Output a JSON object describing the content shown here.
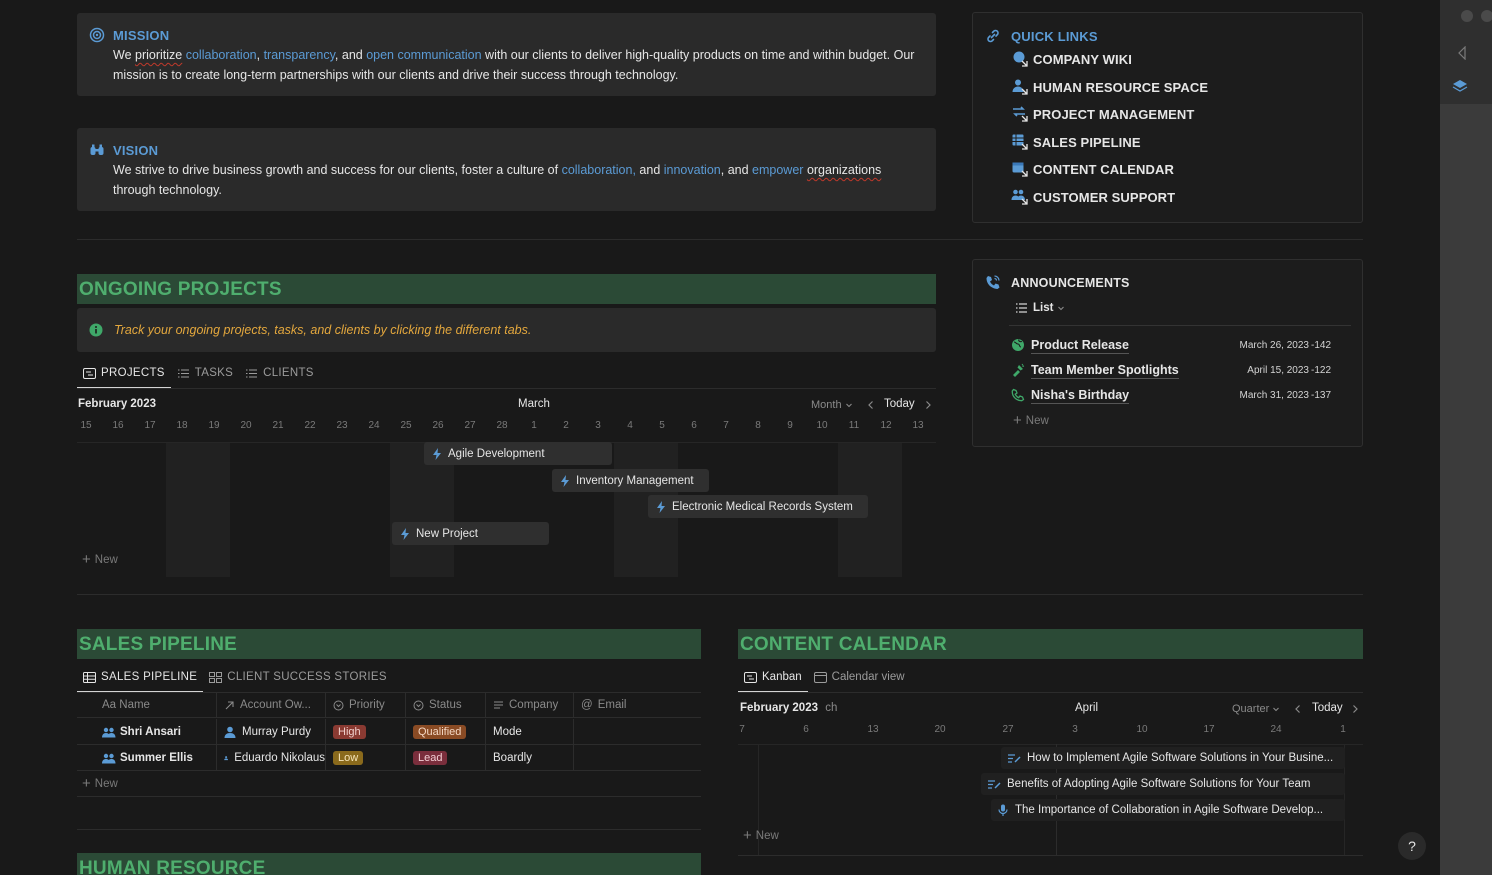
{
  "mission": {
    "title": "MISSION",
    "t1": "We ",
    "t2": "prioritize",
    "t3": " ",
    "l1": "collaboration",
    "t4": ", ",
    "l2": "transparency",
    "t5": ", and ",
    "l3": "open communication",
    "t6": " with our clients to deliver high-quality products on time and within budget. Our mission is to create long-term partnerships with our clients and drive their success through technology."
  },
  "vision": {
    "title": "VISION",
    "t1": "We strive to drive business growth and success for our clients, foster a culture of ",
    "l1": "collaboration,",
    "t2": " and ",
    "l2": "innovation",
    "t3": ", and ",
    "l3": "empower",
    "t4": " ",
    "t5": "organizations",
    "t6": " through technology."
  },
  "quick_links": {
    "title": "QUICK LINKS",
    "items": [
      {
        "label": "COMPANY WIKI"
      },
      {
        "label": "HUMAN RESOURCE SPACE"
      },
      {
        "label": "PROJECT MANAGEMENT"
      },
      {
        "label": "SALES PIPELINE"
      },
      {
        "label": "CONTENT CALENDAR"
      },
      {
        "label": "CUSTOMER SUPPORT"
      }
    ]
  },
  "announcements": {
    "title": "ANNOUNCEMENTS",
    "view_label": "List",
    "items": [
      {
        "title": "Product Release",
        "date": "March 26, 2023",
        "num": "-142",
        "icon": "globe-icon"
      },
      {
        "title": "Team Member Spotlights",
        "date": "April 15, 2023",
        "num": "-122",
        "icon": "flashlight-icon"
      },
      {
        "title": "Nisha's Birthday",
        "date": "March 31, 2023",
        "num": "-137",
        "icon": "phone-icon"
      }
    ],
    "new_label": "New"
  },
  "ongoing": {
    "title": "ONGOING PROJECTS",
    "callout": "Track your ongoing projects, tasks, and clients by clicking the different tabs.",
    "tabs": [
      "PROJECTS",
      "TASKS",
      "CLIENTS"
    ],
    "month_left": "February 2023",
    "month_center": "March",
    "scale_label": "Month",
    "today_label": "Today",
    "days": [
      "15",
      "16",
      "17",
      "18",
      "19",
      "20",
      "21",
      "22",
      "23",
      "24",
      "25",
      "26",
      "27",
      "28",
      "1",
      "2",
      "3",
      "4",
      "5",
      "6",
      "7",
      "8",
      "9",
      "10",
      "11",
      "12",
      "13"
    ],
    "bars": [
      {
        "label": "Agile Development"
      },
      {
        "label": "Inventory Management"
      },
      {
        "label": "Electronic Medical Records System"
      },
      {
        "label": "New Project"
      }
    ],
    "new_label": "New"
  },
  "sales": {
    "title": "SALES PIPELINE",
    "tabs": [
      "SALES PIPELINE",
      "CLIENT SUCCESS STORIES"
    ],
    "columns": [
      "Aa Name",
      "Account Ow...",
      "Priority",
      "Status",
      "Company",
      "Email"
    ],
    "rows": [
      {
        "name": "Shri Ansari",
        "owner": "Murray Purdy",
        "priority": "High",
        "status": "Qualified",
        "company": "Mode",
        "email": ""
      },
      {
        "name": "Summer Ellis",
        "owner": "Eduardo Nikolaus",
        "priority": "Low",
        "status": "Lead",
        "company": "Boardly",
        "email": ""
      }
    ],
    "new_label": "New"
  },
  "content": {
    "title": "CONTENT CALENDAR",
    "tabs": [
      "Kanban",
      "Calendar view"
    ],
    "month_left": "February 2023",
    "month_left_suffix": "ch",
    "month_center": "April",
    "scale_label": "Quarter",
    "today_label": "Today",
    "days": [
      "7",
      "6",
      "13",
      "20",
      "27",
      "3",
      "10",
      "17",
      "24",
      "1"
    ],
    "items": [
      {
        "label": "How to Implement Agile Software Solutions in Your Busine..."
      },
      {
        "label": "Benefits of Adopting Agile Software Solutions for Your Team"
      },
      {
        "label": "The Importance of Collaboration in Agile Software Develop..."
      }
    ],
    "new_label": "New"
  },
  "human_resource": {
    "title": "HUMAN RESOURCE"
  },
  "help_label": "?",
  "colors": {
    "accent": "#5b9bd5",
    "section_bg": "#2b4a36",
    "section_text": "#4fae6e",
    "callout_text": "#e3a73d"
  }
}
